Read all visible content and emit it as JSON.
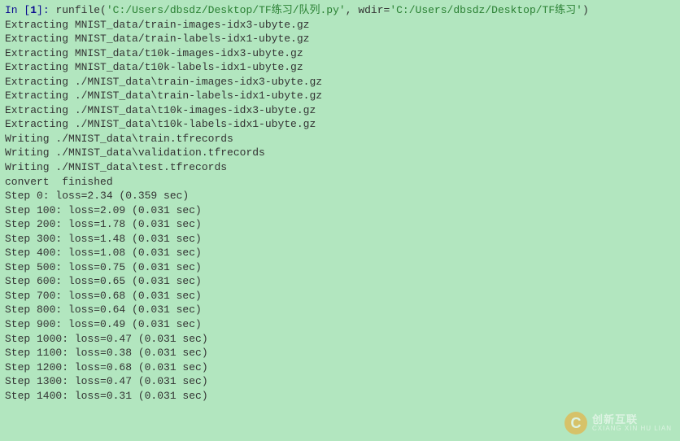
{
  "prompt": {
    "prefix": "In [",
    "number": "1",
    "suffix": "]: ",
    "func": "runfile",
    "open": "(",
    "arg1": "'C:/Users/dbsdz/Desktop/TF练习/队列.py'",
    "comma": ", ",
    "kwarg": "wdir=",
    "arg2": "'C:/Users/dbsdz/Desktop/TF练习'",
    "close": ")"
  },
  "output_lines": [
    "Extracting MNIST_data/train-images-idx3-ubyte.gz",
    "Extracting MNIST_data/train-labels-idx1-ubyte.gz",
    "Extracting MNIST_data/t10k-images-idx3-ubyte.gz",
    "Extracting MNIST_data/t10k-labels-idx1-ubyte.gz",
    "Extracting ./MNIST_data\\train-images-idx3-ubyte.gz",
    "Extracting ./MNIST_data\\train-labels-idx1-ubyte.gz",
    "Extracting ./MNIST_data\\t10k-images-idx3-ubyte.gz",
    "Extracting ./MNIST_data\\t10k-labels-idx1-ubyte.gz",
    "Writing ./MNIST_data\\train.tfrecords",
    "Writing ./MNIST_data\\validation.tfrecords",
    "Writing ./MNIST_data\\test.tfrecords",
    "convert  finished",
    "Step 0: loss=2.34 (0.359 sec)",
    "Step 100: loss=2.09 (0.031 sec)",
    "Step 200: loss=1.78 (0.031 sec)",
    "Step 300: loss=1.48 (0.031 sec)",
    "Step 400: loss=1.08 (0.031 sec)",
    "Step 500: loss=0.75 (0.031 sec)",
    "Step 600: loss=0.65 (0.031 sec)",
    "Step 700: loss=0.68 (0.031 sec)",
    "Step 800: loss=0.64 (0.031 sec)",
    "Step 900: loss=0.49 (0.031 sec)",
    "Step 1000: loss=0.47 (0.031 sec)",
    "Step 1100: loss=0.38 (0.031 sec)",
    "Step 1200: loss=0.68 (0.031 sec)",
    "Step 1300: loss=0.47 (0.031 sec)",
    "Step 1400: loss=0.31 (0.031 sec)"
  ],
  "watermark": {
    "icon_letter": "C",
    "cn": "创新互联",
    "py": "CXIANG XIN HU LIAN"
  }
}
